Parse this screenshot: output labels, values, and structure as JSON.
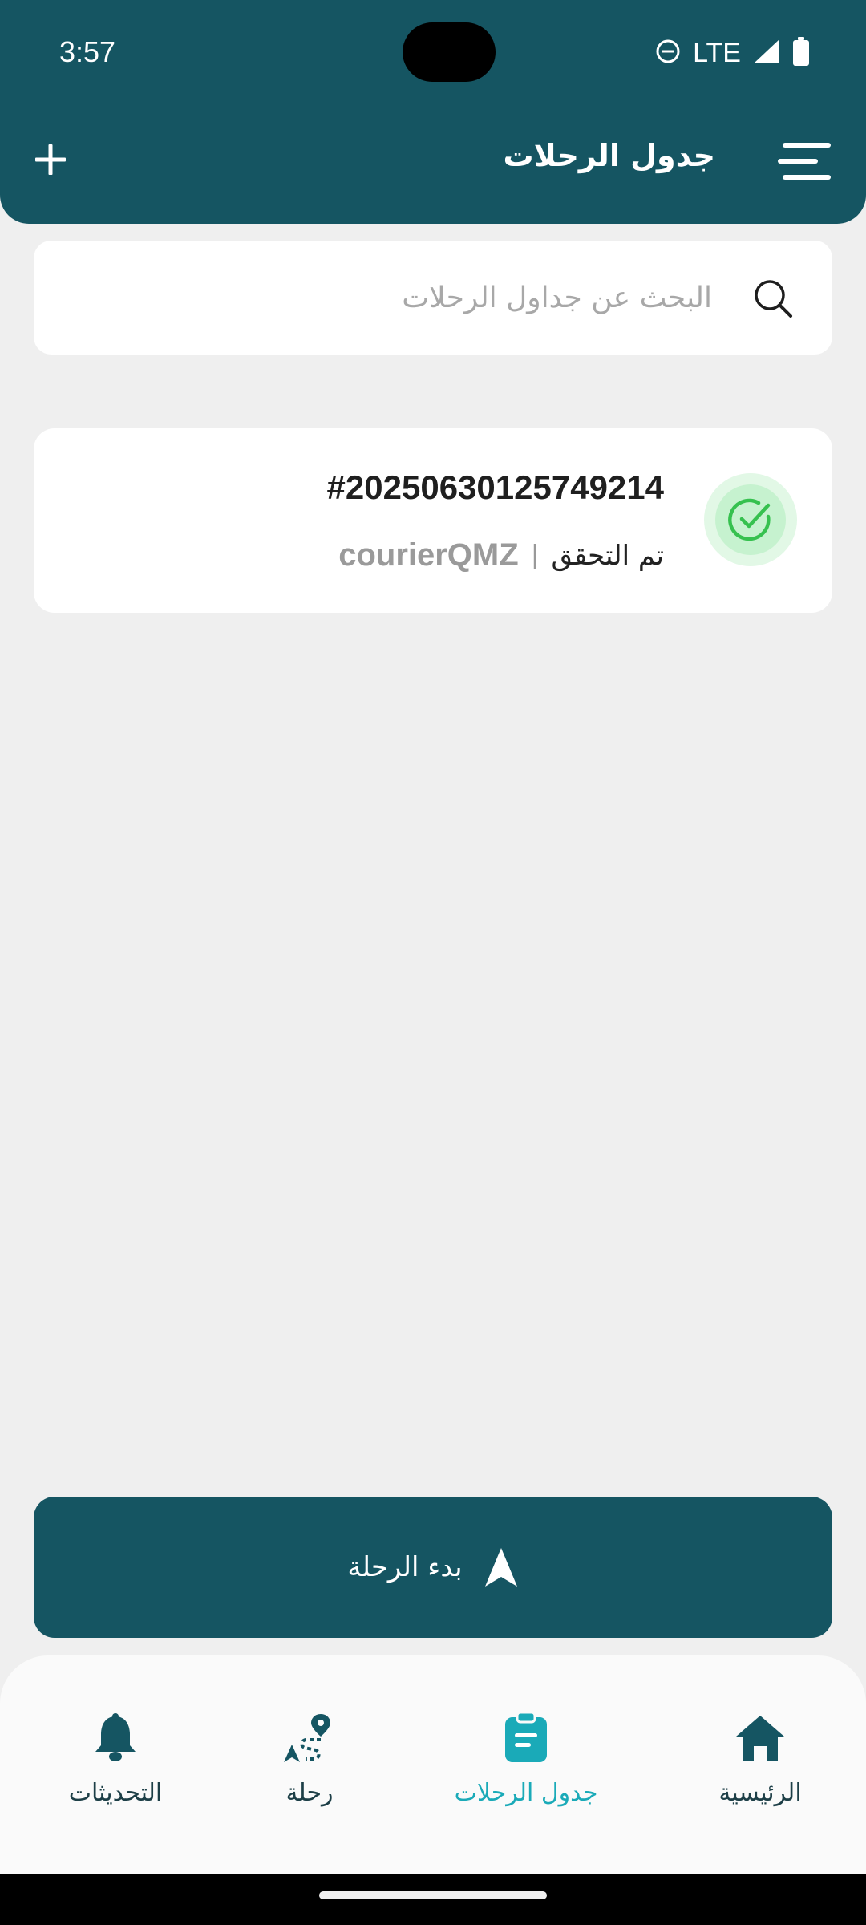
{
  "status_bar": {
    "time": "3:57",
    "network": "LTE",
    "icons": [
      "do-not-disturb-icon",
      "signal-icon",
      "battery-icon"
    ]
  },
  "app_bar": {
    "title": "جدول الرحلات",
    "left_action_icon": "plus-icon",
    "right_action_icon": "menu-icon"
  },
  "search": {
    "placeholder": "البحث عن جداول الرحلات",
    "value": "",
    "icon": "search-icon"
  },
  "trips": [
    {
      "id": "#20250630125749214",
      "status": "تم التحقق",
      "separator": "|",
      "courier": "courierQMZ",
      "status_icon": "check-circle-icon",
      "status_color": "#36c14f"
    }
  ],
  "start_button": {
    "label": "بدء الرحلة",
    "icon": "navigation-arrow-icon"
  },
  "bottom_nav": {
    "items": [
      {
        "label": "الرئيسية",
        "icon": "home-icon",
        "active": false
      },
      {
        "label": "جدول الرحلات",
        "icon": "clipboard-icon",
        "active": true
      },
      {
        "label": "رحلة",
        "icon": "route-icon",
        "active": false
      },
      {
        "label": "التحديثات",
        "icon": "bell-icon",
        "active": false
      }
    ]
  },
  "colors": {
    "primary": "#155562",
    "accent": "#1aaab8",
    "background": "#efefef",
    "success": "#36c14f"
  }
}
